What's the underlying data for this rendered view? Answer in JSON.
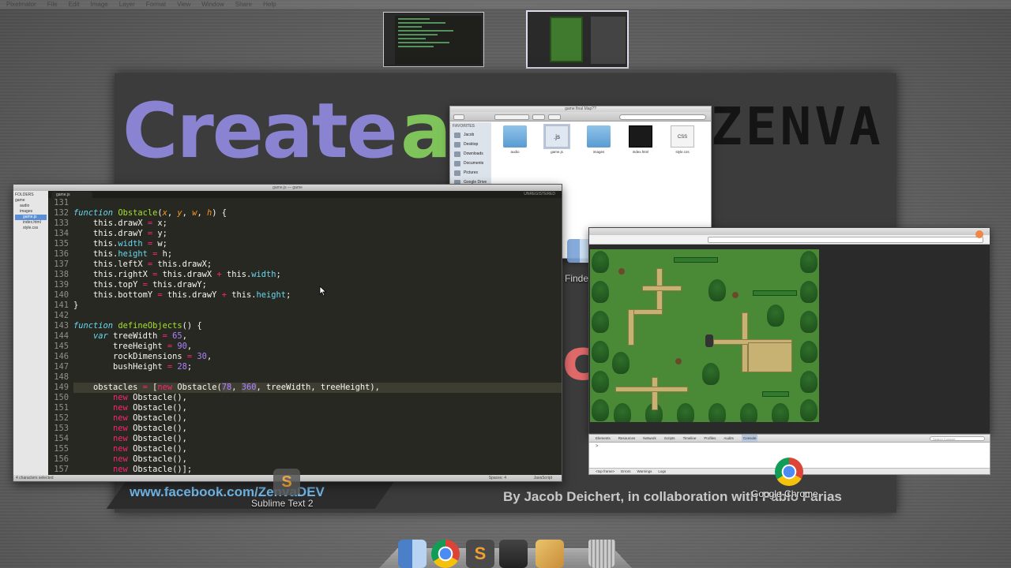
{
  "menubar": {
    "items": [
      "Pixelmator",
      "File",
      "Edit",
      "Image",
      "Layer",
      "Format",
      "View",
      "Window",
      "Share",
      "Help"
    ]
  },
  "slide": {
    "title_word": "Create",
    "title_a": "a",
    "brand": "ZENVA",
    "facebook": "www.facebook.com/ZenvaDEV",
    "byline": "By Jacob Deichert, in collaboration with Pablo Farias",
    "partial_c": "c",
    "colors": {
      "title": "#8a83d2",
      "accent_green": "#7fc45a",
      "facebook": "#6fb7e8"
    }
  },
  "sublime": {
    "window_title": "game.js — game",
    "tab": "game.js",
    "unregistered": "UNREGISTERED",
    "sidebar": {
      "header": "FOLDERS",
      "items": [
        "game",
        "audio",
        "images",
        "game.js",
        "index.html",
        "style.css"
      ]
    },
    "line_numbers": [
      "131",
      "132",
      "133",
      "134",
      "135",
      "136",
      "137",
      "138",
      "139",
      "140",
      "141",
      "142",
      "143",
      "144",
      "145",
      "146",
      "147",
      "148",
      "149",
      "150",
      "151",
      "152",
      "153",
      "154",
      "155",
      "156",
      "157"
    ],
    "status": {
      "left": "4 characters selected",
      "spaces": "Spaces: 4",
      "syntax": "JavaScript"
    }
  },
  "finder": {
    "window_title": "game final Map??",
    "sidebar_header": "FAVORITES",
    "sidebar_items": [
      "Jacob",
      "Desktop",
      "Downloads",
      "Documents",
      "Pictures",
      "Google Drive"
    ],
    "files": [
      {
        "name": "audio",
        "kind": "folder"
      },
      {
        "name": "game.js",
        "kind": "js",
        "glyph": ".js"
      },
      {
        "name": "images",
        "kind": "folder"
      },
      {
        "name": "index.html",
        "kind": "html"
      },
      {
        "name": "style.css",
        "kind": "css",
        "glyph": "CSS"
      }
    ]
  },
  "devtools": {
    "tabs": [
      "Elements",
      "Resources",
      "Network",
      "Scripts",
      "Timeline",
      "Profiles",
      "Audits",
      "Console"
    ],
    "selected_tab": "Console",
    "search_placeholder": "Search Console",
    "bottom": [
      "<top frame>",
      "Errors",
      "Warnings",
      "Logs"
    ],
    "prompt": ">"
  },
  "labels": {
    "finder": "Finder",
    "sublime": "Sublime Text 2",
    "chrome": "Google Chrome",
    "sublime_glyph": "S"
  }
}
